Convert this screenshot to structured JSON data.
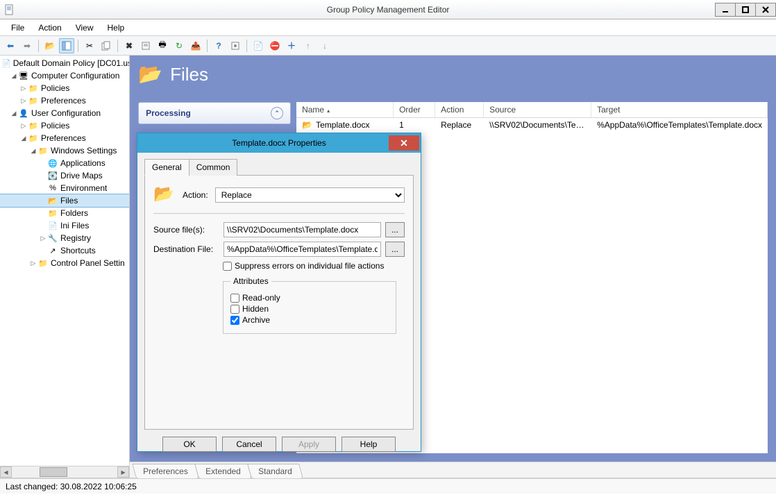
{
  "window": {
    "title": "Group Policy Management Editor"
  },
  "menubar": [
    "File",
    "Action",
    "View",
    "Help"
  ],
  "tree": {
    "root": "Default Domain Policy [DC01.us",
    "cc": "Computer Configuration",
    "cc_pol": "Policies",
    "cc_pref": "Preferences",
    "uc": "User Configuration",
    "uc_pol": "Policies",
    "uc_pref": "Preferences",
    "ws": "Windows Settings",
    "apps": "Applications",
    "dm": "Drive Maps",
    "env": "Environment",
    "files": "Files",
    "folders": "Folders",
    "ini": "Ini Files",
    "reg": "Registry",
    "sc": "Shortcuts",
    "cps": "Control Panel Settin"
  },
  "content": {
    "heading": "Files",
    "sidecard": "Processing",
    "cols": {
      "name": "Name",
      "order": "Order",
      "action": "Action",
      "source": "Source",
      "target": "Target"
    },
    "row": {
      "name": "Template.docx",
      "order": "1",
      "action": "Replace",
      "source": "\\\\SRV02\\Documents\\Tem...",
      "target": "%AppData%\\OfficeTemplates\\Template.docx"
    }
  },
  "bottomtabs": [
    "Preferences",
    "Extended",
    "Standard"
  ],
  "statusbar": "Last changed: 30.08.2022 10:06:25",
  "dialog": {
    "title": "Template.docx Properties",
    "tabs": {
      "general": "General",
      "common": "Common"
    },
    "action_label": "Action:",
    "action_value": "Replace",
    "source_label": "Source file(s):",
    "source_value": "\\\\SRV02\\Documents\\Template.docx",
    "dest_label": "Destination File:",
    "dest_value": "%AppData%\\OfficeTemplates\\Template.docx",
    "suppress": "Suppress errors on individual file actions",
    "attrs_legend": "Attributes",
    "attr_ro": "Read-only",
    "attr_hidden": "Hidden",
    "attr_archive": "Archive",
    "btn_ok": "OK",
    "btn_cancel": "Cancel",
    "btn_apply": "Apply",
    "btn_help": "Help"
  }
}
